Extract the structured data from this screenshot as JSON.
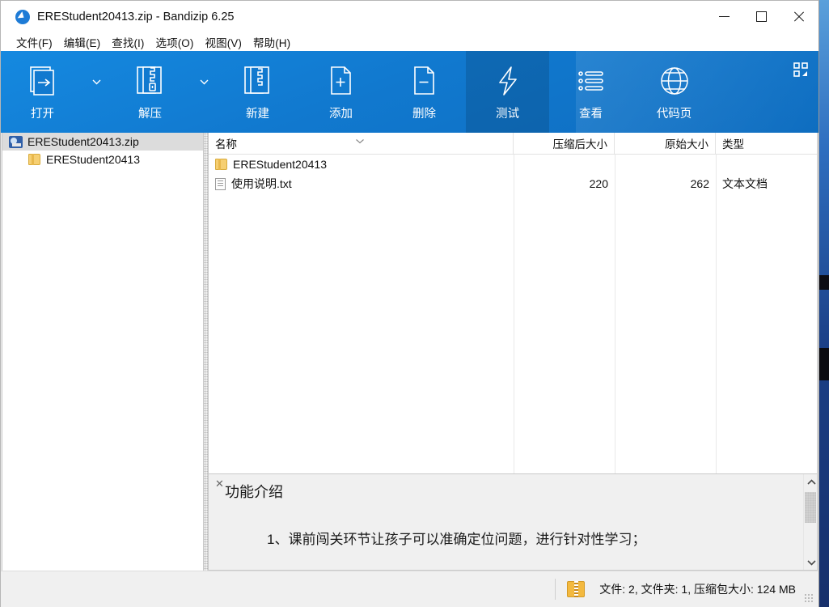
{
  "window": {
    "title": "EREStudent20413.zip - Bandizip 6.25",
    "app_icon": "bandizip-icon",
    "controls": {
      "minimize": "minimize-button",
      "maximize": "maximize-button",
      "close": "close-button"
    }
  },
  "menu": [
    {
      "label": "文件(F)",
      "key": "F"
    },
    {
      "label": "编辑(E)",
      "key": "E"
    },
    {
      "label": "查找(I)",
      "key": "I"
    },
    {
      "label": "选项(O)",
      "key": "O"
    },
    {
      "label": "视图(V)",
      "key": "V"
    },
    {
      "label": "帮助(H)",
      "key": "H"
    }
  ],
  "toolbar": {
    "accent_color": "#1179cf",
    "active_color": "#0d63ad",
    "buttons": [
      {
        "label": "打开",
        "icon": "open-archive-icon",
        "has_dropdown": true,
        "active": false
      },
      {
        "label": "解压",
        "icon": "extract-icon",
        "has_dropdown": true,
        "active": false
      },
      {
        "label": "新建",
        "icon": "new-archive-icon",
        "has_dropdown": false,
        "active": false
      },
      {
        "label": "添加",
        "icon": "add-file-icon",
        "has_dropdown": false,
        "active": false
      },
      {
        "label": "删除",
        "icon": "delete-file-icon",
        "has_dropdown": false,
        "active": false
      },
      {
        "label": "测试",
        "icon": "test-lightning-icon",
        "has_dropdown": false,
        "active": true
      },
      {
        "label": "查看",
        "icon": "view-list-icon",
        "has_dropdown": false,
        "active": false
      },
      {
        "label": "代码页",
        "icon": "globe-codepage-icon",
        "has_dropdown": false,
        "active": false
      }
    ],
    "customize_icon": "customize-grid-icon"
  },
  "tree": {
    "items": [
      {
        "label": "EREStudent20413.zip",
        "icon": "zip-archive-icon",
        "level": 0,
        "selected": true
      },
      {
        "label": "EREStudent20413",
        "icon": "folder-icon",
        "level": 1,
        "selected": false
      }
    ]
  },
  "file_list": {
    "columns": [
      {
        "label": "名称",
        "align": "left",
        "sorted": true,
        "sort_icon": "chevron-down-icon"
      },
      {
        "label": "压缩后大小",
        "align": "right"
      },
      {
        "label": "原始大小",
        "align": "right"
      },
      {
        "label": "类型",
        "align": "left"
      }
    ],
    "rows": [
      {
        "name": "EREStudent20413",
        "icon": "folder-icon",
        "compressed_size": "",
        "original_size": "",
        "type": ""
      },
      {
        "name": "使用说明.txt",
        "icon": "text-file-icon",
        "compressed_size": "220",
        "original_size": "262",
        "type": "文本文档"
      }
    ],
    "hscroll": {
      "thumb_percent": 73,
      "left_arrow": "chevron-left-icon",
      "right_arrow": "chevron-right-icon"
    }
  },
  "preview": {
    "close_icon": "close-icon",
    "title": "功能介绍",
    "text": "1、课前闯关环节让孩子可以准确定位问题，进行针对性学习；",
    "vscroll": {
      "up_arrow": "chevron-up-icon",
      "down_arrow": "chevron-down-icon"
    }
  },
  "status_bar": {
    "icon": "zip-folder-icon",
    "text": "文件: 2, 文件夹: 1, 压缩包大小: 124 MB",
    "grip": "resize-grip"
  }
}
